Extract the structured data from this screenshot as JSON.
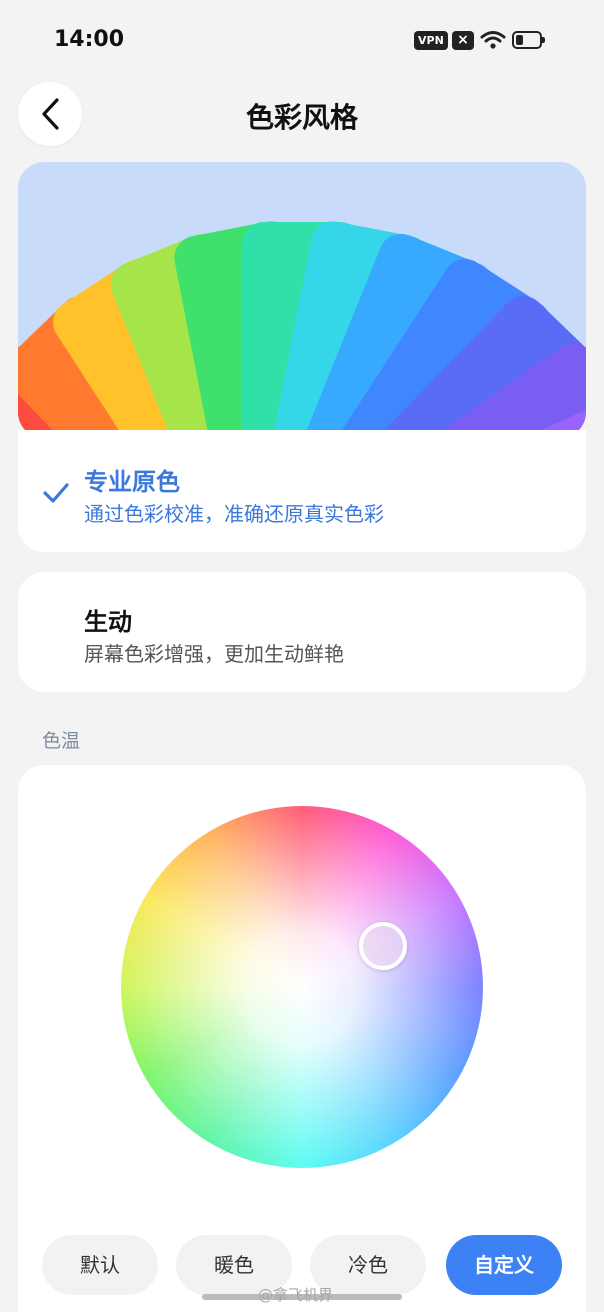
{
  "status_bar": {
    "time": "14:00",
    "vpn": "VPN",
    "icons": [
      "vpn-icon",
      "x-icon",
      "wifi-icon",
      "battery-icon"
    ]
  },
  "header": {
    "title": "色彩风格",
    "back_icon": "chevron-left-icon"
  },
  "options": {
    "pro": {
      "title": "专业原色",
      "subtitle": "通过色彩校准，准确还原真实色彩",
      "selected": true
    },
    "vivid": {
      "title": "生动",
      "subtitle": "屏幕色彩增强，更加生动鲜艳",
      "selected": false
    }
  },
  "color_temp": {
    "label": "色温",
    "buttons": [
      "默认",
      "暖色",
      "冷色",
      "自定义"
    ],
    "active_button": "自定义"
  },
  "watermark": "@拿飞机界",
  "colors": {
    "accent": "#3b78de",
    "active_button": "#3c82f5",
    "hero_bg": "#c9dbfb",
    "page_bg": "#f3f3f3"
  }
}
